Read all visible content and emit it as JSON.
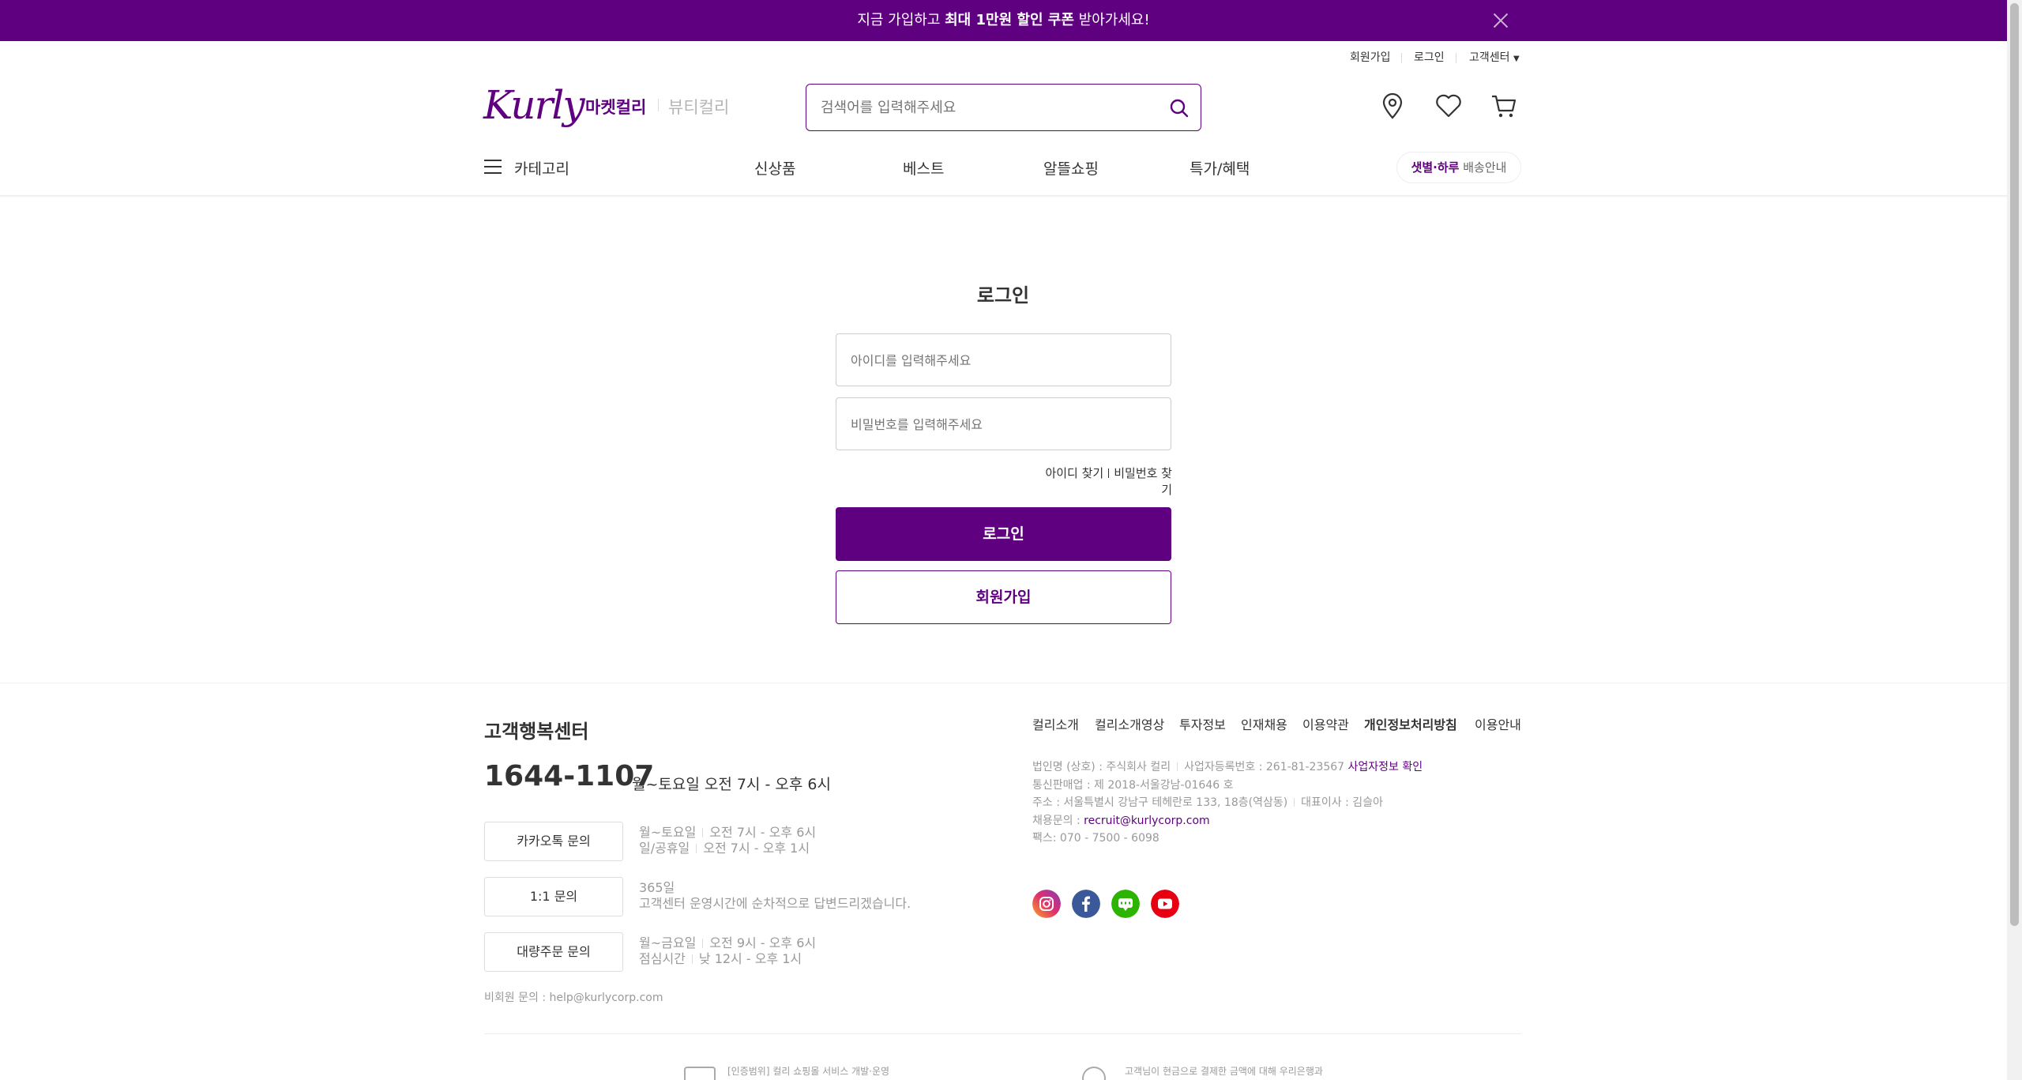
{
  "banner": {
    "pre": "지금 가입하고 ",
    "bold": "최대 1만원 할인 쿠폰",
    "post": " 받아가세요!"
  },
  "util": {
    "signup": "회원가입",
    "login": "로그인",
    "support": "고객센터"
  },
  "header": {
    "logo": "Kurly",
    "market": "마켓컬리",
    "beauty": "뷰티컬리",
    "search_placeholder": "검색어를 입력해주세요"
  },
  "gnb": {
    "category": "카테고리",
    "items": [
      "신상품",
      "베스트",
      "알뜰쇼핑",
      "특가/혜택"
    ],
    "delivery_bold": "샛별·하루",
    "delivery_text": " 배송안내"
  },
  "login": {
    "title": "로그인",
    "id_placeholder": "아이디를 입력해주세요",
    "pw_placeholder": "비밀번호를 입력해주세요",
    "find_id": "아이디 찾기",
    "find_pw": "비밀번호 찾기",
    "login_button": "로그인",
    "signup_button": "회원가입"
  },
  "footer": {
    "cs_title": "고객행복센터",
    "phone": "1644-1107",
    "phone_hours": "월~토요일 오전 7시 - 오후 6시",
    "cs_buttons": [
      {
        "label": "카카오톡 문의",
        "line1a": "월~토요일",
        "line1b": "오전 7시 - 오후 6시",
        "line2a": "일/공휴일",
        "line2b": "오전 7시 - 오후 1시"
      },
      {
        "label": "1:1 문의",
        "line1": "365일",
        "line2": "고객센터 운영시간에 순차적으로 답변드리겠습니다."
      },
      {
        "label": "대량주문 문의",
        "line1a": "월~금요일",
        "line1b": "오전 9시 - 오후 6시",
        "line2a": "점심시간",
        "line2b": "낮 12시 - 오후 1시"
      }
    ],
    "nonmember": "비회원 문의 : help@kurlycorp.com",
    "links": [
      "컬리소개",
      "컬리소개영상",
      "투자정보",
      "인재채용",
      "이용약관",
      "개인정보처리방침",
      "이용안내"
    ],
    "corp": {
      "name": "법인명 (상호) : 주식회사 컬리",
      "biz_no": "사업자등록번호 : 261-81-23567",
      "biz_check": "사업자정보 확인",
      "mail_order": "통신판매업 : 제 2018-서울강남-01646 호",
      "address": "주소 : 서울특별시 강남구 테헤란로 133, 18층(역삼동)",
      "ceo": "대표이사 : 김슬아",
      "recruit_label": "채용문의 : ",
      "recruit_email": "recruit@kurlycorp.com",
      "fax": "팩스: 070 - 7500 - 6098"
    },
    "sns": [
      "instagram-icon",
      "facebook-icon",
      "naver-blog-icon",
      "youtube-icon"
    ],
    "cert1": "[인증범위] 컬리 쇼핑몰 서비스 개발·운영",
    "cert2": "고객님이 현금으로 결제한 금액에 대해 우리은행과"
  },
  "colors": {
    "brand": "#5f0080"
  }
}
